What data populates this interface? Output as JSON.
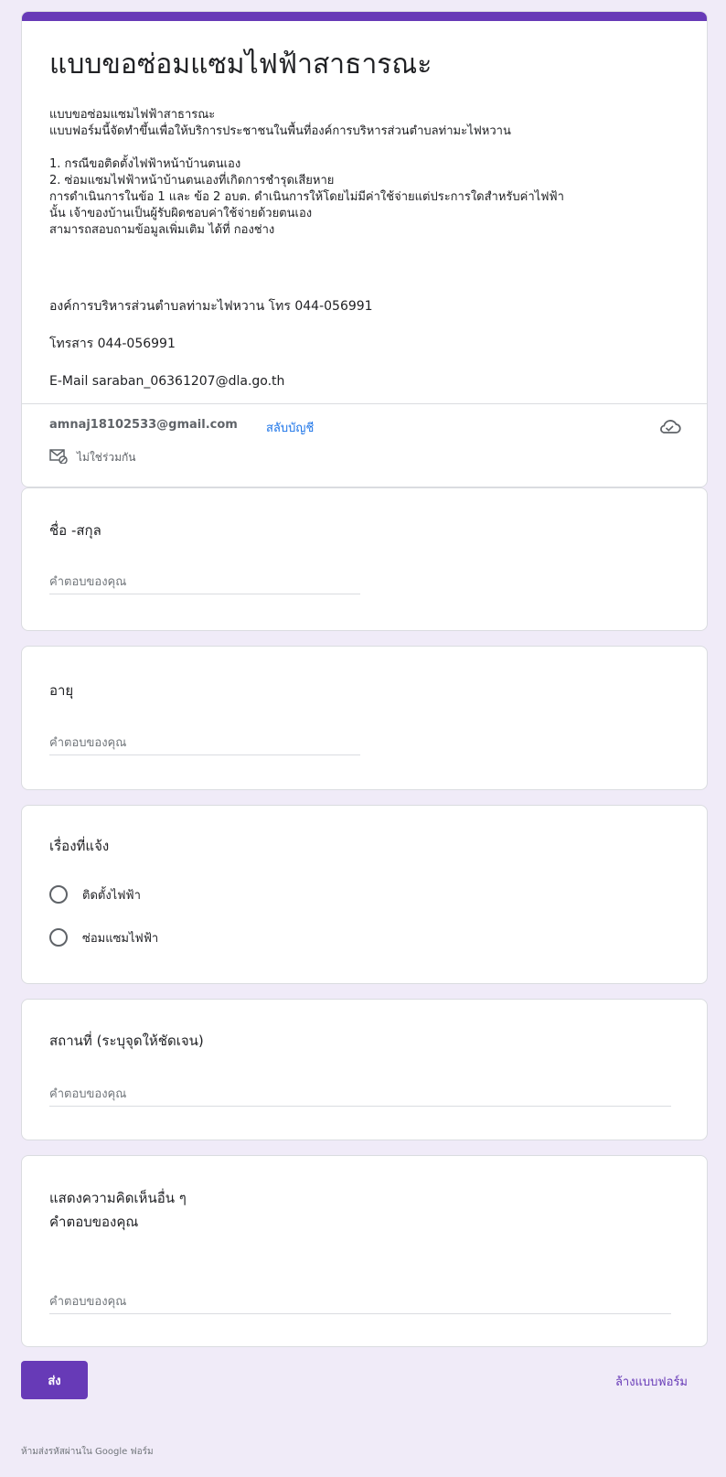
{
  "header": {
    "title": "แบบขอซ่อมแซมไฟฟ้าสาธารณะ",
    "description_lines": [
      "แบบขอซ่อมแซมไฟฟ้าสาธารณะ",
      "แบบฟอร์มนี้จัดทำขึ้นเพื่อให้บริการประชาชนในพื้นที่องค์การบริหารส่วนตำบลท่ามะไฟหวาน",
      "",
      "1. กรณีขอติดตั้งไฟฟ้าหน้าบ้านตนเอง",
      "2. ซ่อมแซมไฟฟ้าหน้าบ้านตนเองที่เกิดการชำรุดเสียหาย",
      "การดำเนินการในข้อ 1 และ ข้อ 2 อบต. ดำเนินการให้โดยไม่มีค่าใช้จ่ายแต่ประการใดสำหรับค่าไฟฟ้า",
      "นั้น เจ้าของบ้านเป็นผู้รับผิดชอบค่าใช้จ่ายด้วยตนเอง",
      "สามารถสอบถามข้อมูลเพิ่มเติม ได้ที่ กองช่าง"
    ],
    "contact_org": "องค์การบริหารส่วนตำบลท่ามะไฟหวาน  โทร 044-056991",
    "contact_fax": "โทรสาร 044-056991",
    "contact_email": "E-Mail   saraban_06361207@dla.go.th"
  },
  "account": {
    "email": "amnaj18102533@gmail.com",
    "switch_label": "สลับบัญชี",
    "not_shared_label": "ไม่ใช่ร่วมกัน"
  },
  "questions": [
    {
      "label": "ชื่อ -สกุล",
      "placeholder": "คำตอบของคุณ"
    },
    {
      "label": "อายุ",
      "placeholder": "คำตอบของคุณ"
    },
    {
      "label": "เรื่องที่แจ้ง",
      "options": [
        "ติดตั้งไฟฟ้า",
        "ซ่อมแซมไฟฟ้า"
      ]
    },
    {
      "label": "สถานที่ (ระบุจุดให้ชัดเจน)",
      "placeholder": "คำตอบของคุณ"
    },
    {
      "label": "แสดงความคิดเห็นอื่น ๆ",
      "sublabel": "คำตอบของคุณ",
      "placeholder": "คำตอบของคุณ"
    }
  ],
  "actions": {
    "submit_label": "ส่ง",
    "clear_label": "ล้างแบบฟอร์ม"
  },
  "footer": {
    "note": "ห้ามส่งรหัสผ่านใน Google ฟอร์ม"
  },
  "colors": {
    "accent": "#673ab7",
    "link": "#1a73e8",
    "background": "#f0ebf8"
  }
}
